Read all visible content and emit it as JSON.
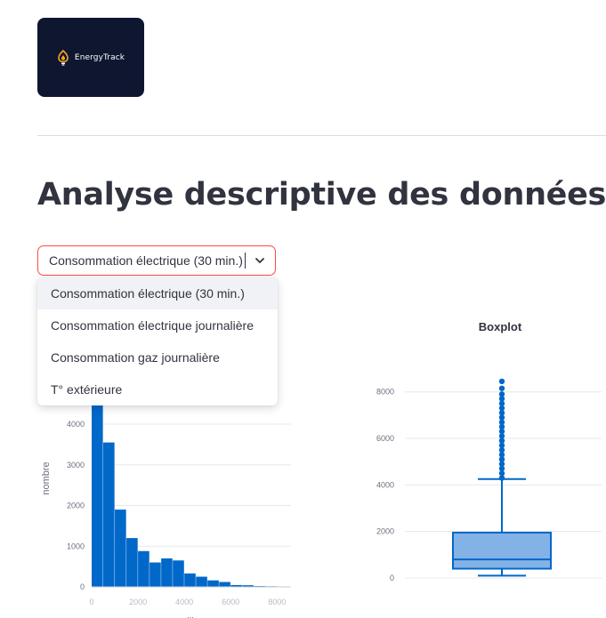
{
  "logo": {
    "text": "EnergyTrack",
    "icon": "lightbulb-flame-icon",
    "bg": "#0e1630",
    "accent": "#f5a623"
  },
  "page": {
    "title": "Analyse descriptive des données"
  },
  "select": {
    "value": "Consommation électrique (30 min.)",
    "border_color": "#ff4b4b",
    "options": [
      "Consommation électrique (30 min.)",
      "Consommation électrique journalière",
      "Consommation gaz journalière",
      "T° extérieure"
    ],
    "highlighted_index": 0
  },
  "chart_data": [
    {
      "type": "bar",
      "title": "",
      "ylabel": "nombre",
      "xlabel": "...",
      "ylim": [
        0,
        4700
      ],
      "xlim": [
        0,
        8600
      ],
      "bin_width": 500,
      "yticks": [
        0,
        1000,
        2000,
        3000,
        4000
      ],
      "xticks": [
        0,
        2000,
        4000,
        6000,
        8000
      ],
      "values": [
        4700,
        3550,
        1900,
        1200,
        880,
        600,
        700,
        650,
        330,
        250,
        160,
        120,
        45,
        40,
        20,
        15,
        10
      ],
      "color": "#0068c9",
      "grid": true
    },
    {
      "type": "box",
      "title": "Boxplot",
      "ylim": [
        0,
        8600
      ],
      "yticks": [
        0,
        2000,
        4000,
        6000,
        8000
      ],
      "min": 100,
      "q1": 400,
      "median": 800,
      "q3": 1950,
      "max": 4250,
      "outliers": [
        4300,
        4500,
        4700,
        4900,
        5100,
        5300,
        5500,
        5700,
        5900,
        6100,
        6300,
        6500,
        6700,
        6900,
        7100,
        7300,
        7500,
        7700,
        7900,
        8150,
        8450
      ],
      "color": "#0068c9",
      "fill": "#83b3e6",
      "grid": true
    }
  ]
}
